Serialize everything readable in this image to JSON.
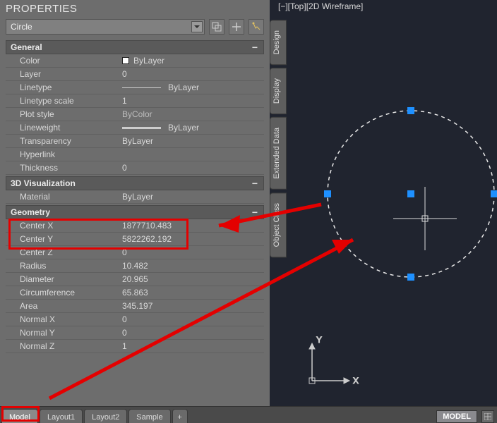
{
  "panel": {
    "title": "PROPERTIES",
    "object_type": "Circle",
    "sections": {
      "general": {
        "title": "General",
        "rows": {
          "color_label": "Color",
          "color_value": "ByLayer",
          "layer_label": "Layer",
          "layer_value": "0",
          "linetype_label": "Linetype",
          "linetype_value": "ByLayer",
          "linetype_scale_label": "Linetype scale",
          "linetype_scale_value": "1",
          "plot_style_label": "Plot style",
          "plot_style_value": "ByColor",
          "lineweight_label": "Lineweight",
          "lineweight_value": "ByLayer",
          "transparency_label": "Transparency",
          "transparency_value": "ByLayer",
          "hyperlink_label": "Hyperlink",
          "hyperlink_value": "",
          "thickness_label": "Thickness",
          "thickness_value": "0"
        }
      },
      "viz": {
        "title": "3D Visualization",
        "rows": {
          "material_label": "Material",
          "material_value": "ByLayer"
        }
      },
      "geometry": {
        "title": "Geometry",
        "rows": {
          "center_x_label": "Center X",
          "center_x_value": "1877710.483",
          "center_y_label": "Center Y",
          "center_y_value": "5822262.192",
          "center_z_label": "Center Z",
          "center_z_value": "0",
          "radius_label": "Radius",
          "radius_value": "10.482",
          "diameter_label": "Diameter",
          "diameter_value": "20.965",
          "circumference_label": "Circumference",
          "circumference_value": "65.863",
          "area_label": "Area",
          "area_value": "345.197",
          "normal_x_label": "Normal X",
          "normal_x_value": "0",
          "normal_y_label": "Normal Y",
          "normal_y_value": "0",
          "normal_z_label": "Normal Z",
          "normal_z_value": "1"
        }
      }
    }
  },
  "viewport": {
    "title": "[−][Top][2D Wireframe]",
    "side_tabs": {
      "design": "Design",
      "display": "Display",
      "extended": "Extended Data",
      "object_class": "Object Class"
    },
    "axes": {
      "x": "X",
      "y": "Y"
    }
  },
  "tabs": {
    "model": "Model",
    "layout1": "Layout1",
    "layout2": "Layout2",
    "sample": "Sample",
    "plus": "+"
  },
  "status": {
    "mode": "MODEL"
  }
}
